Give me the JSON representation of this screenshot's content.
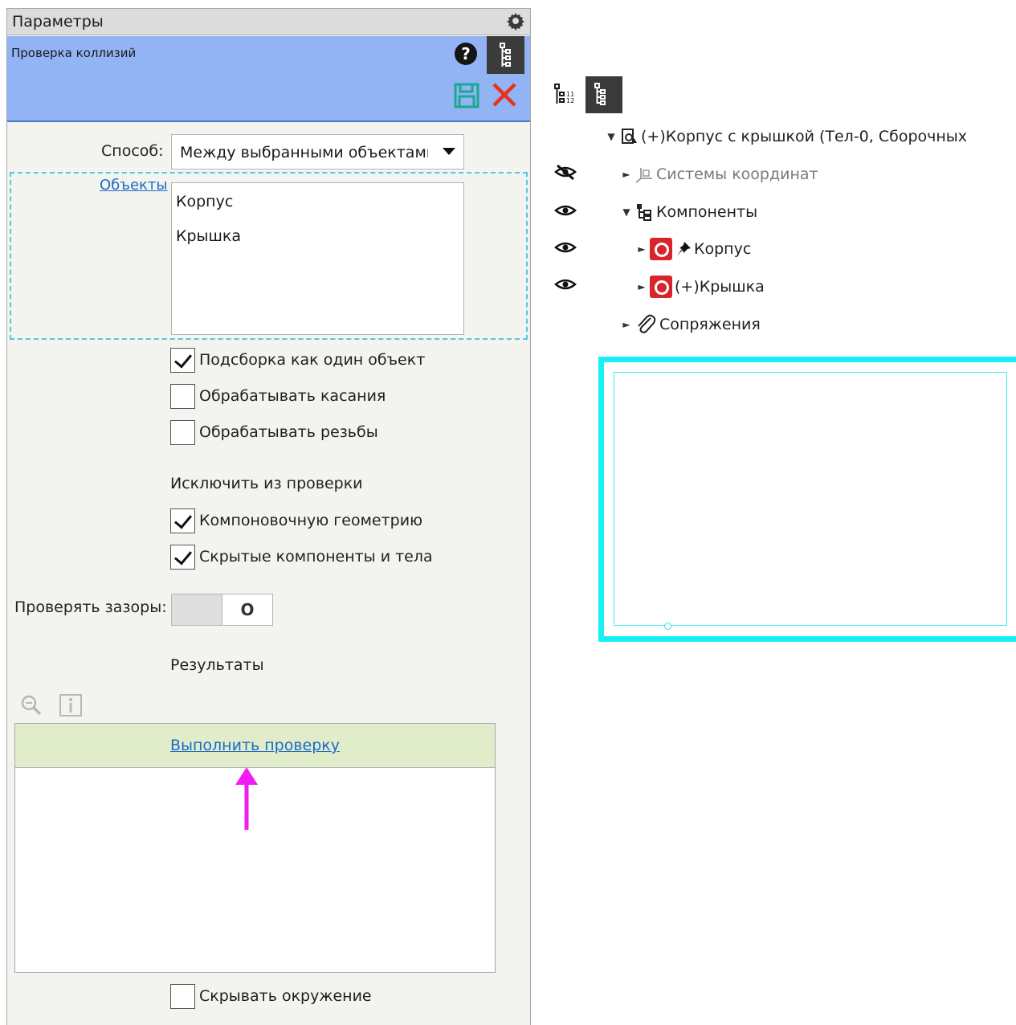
{
  "panel": {
    "title": "Параметры",
    "command_title": "Проверка коллизий",
    "method_label": "Способ:",
    "method_value": "Между выбранными объектами",
    "objects_label": "Объекты",
    "objects": [
      "Корпус",
      "Крышка"
    ],
    "options": [
      {
        "label": "Подсборка как один объект",
        "checked": true
      },
      {
        "label": "Обрабатывать касания",
        "checked": false
      },
      {
        "label": "Обрабатывать резьбы",
        "checked": false
      }
    ],
    "exclude_title": "Исключить из проверки",
    "exclude_options": [
      {
        "label": "Компоновочную геометрию",
        "checked": true
      },
      {
        "label": "Скрытые компоненты и тела",
        "checked": true
      }
    ],
    "gap_label": "Проверять зазоры:",
    "gap_state": "O",
    "results_title": "Результаты",
    "run_check": "Выполнить проверку",
    "hide_env": {
      "label": "Скрывать окружение",
      "checked": false
    },
    "colors": {
      "header": "#dcdcdc",
      "command_bar": "#92b4f5",
      "results_head": "#e1ecca",
      "annotation_arrow": "#f41bf0",
      "close": "#e8321e",
      "save": "#1aa98f"
    }
  },
  "tree": {
    "root": "(+)Корпус с крышкой (Тел-0, Сборочных",
    "items": [
      {
        "label": "Системы координат",
        "icon": "coordinate-system-icon",
        "visible": false
      },
      {
        "label": "Компоненты",
        "icon": "components-icon",
        "visible": true
      },
      {
        "label": "Корпус",
        "icon": "part-icon",
        "prefix_icon": "pin-icon",
        "visible": true
      },
      {
        "label": "(+)Крышка",
        "icon": "part-icon",
        "visible": true
      },
      {
        "label": "Сопряжения",
        "icon": "paperclip-icon"
      }
    ],
    "viewport_color": "#19f0f6"
  }
}
